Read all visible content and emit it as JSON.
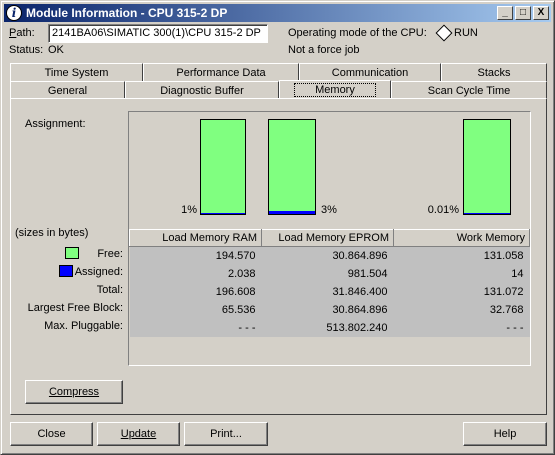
{
  "window": {
    "title": "Module Information - CPU 315-2 DP",
    "minimize_glyph": "_",
    "maximize_glyph": "□",
    "close_glyph": "X"
  },
  "header": {
    "path_label": "Path:",
    "path_value": "2141BA06\\SIMATIC 300(1)\\CPU 315-2 DP",
    "status_label": "Status:",
    "status_value": "OK",
    "opmode_label": "Operating mode of the  CPU:",
    "opmode_value": "RUN",
    "force_text": "Not a force job"
  },
  "tabs": {
    "row1": [
      "Time System",
      "Performance Data",
      "Communication",
      "Stacks"
    ],
    "row2": [
      "General",
      "Diagnostic Buffer",
      "Memory",
      "Scan Cycle Time"
    ],
    "active": "Memory"
  },
  "memory": {
    "assignment_label": "Assignment:",
    "sizes_label": "(sizes in bytes)",
    "bars": [
      {
        "percent_label": "1%",
        "used_fraction": 0.01
      },
      {
        "percent_label": "3%",
        "used_fraction": 0.03
      },
      {
        "percent_label": "0.01%",
        "used_fraction": 0.0001
      }
    ],
    "columns": [
      "Load Memory RAM",
      "Load Memory EPROM",
      "Work Memory"
    ],
    "row_labels": [
      "Free:",
      "Assigned:",
      "Total:",
      "Largest Free Block:",
      "Max. Pluggable:"
    ],
    "rows": [
      [
        "194.570",
        "30.864.896",
        "131.058"
      ],
      [
        "2.038",
        "981.504",
        "14"
      ],
      [
        "196.608",
        "31.846.400",
        "131.072"
      ],
      [
        "65.536",
        "30.864.896",
        "32.768"
      ],
      [
        "- - -",
        "513.802.240",
        "- - -"
      ]
    ],
    "free_color": "#80ff80",
    "assigned_color": "#0000ff"
  },
  "buttons": {
    "compress": "Compress",
    "close": "Close",
    "update": "Update",
    "print": "Print...",
    "help": "Help"
  }
}
